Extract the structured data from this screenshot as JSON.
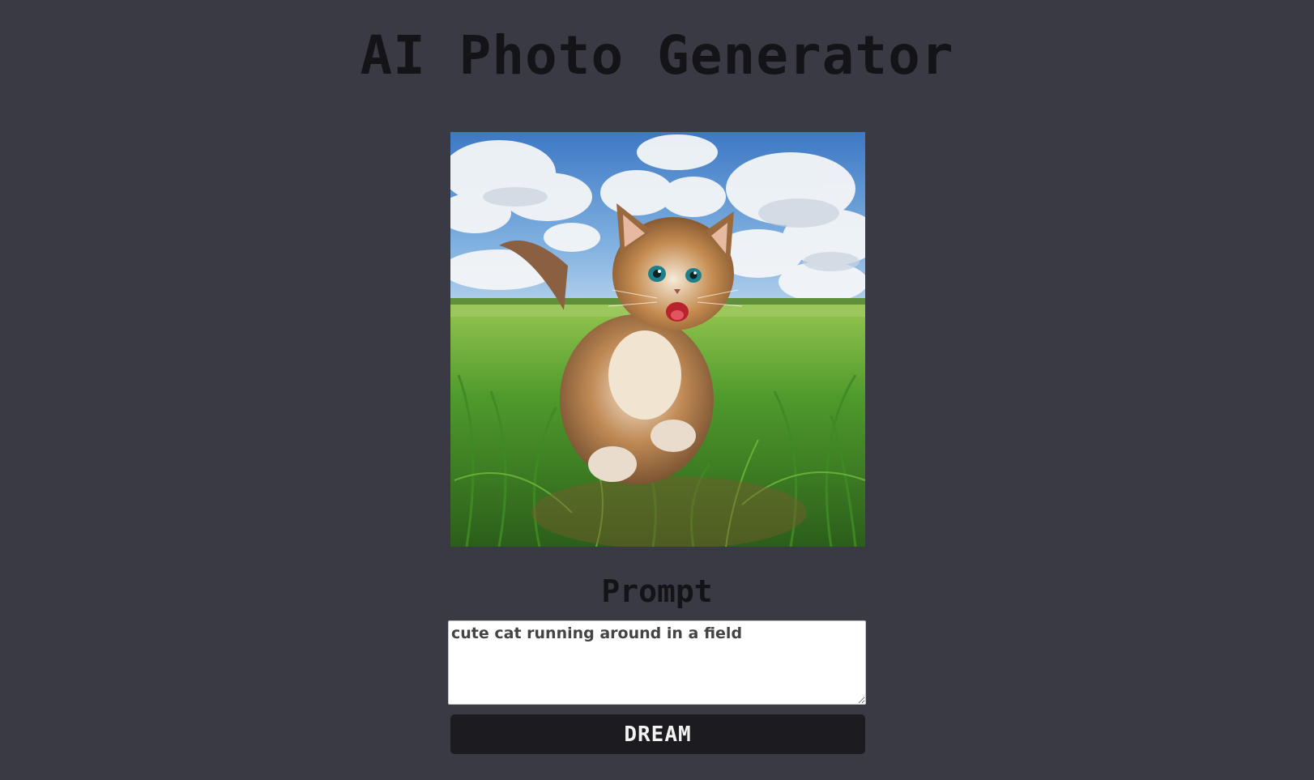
{
  "header": {
    "title": "AI Photo Generator"
  },
  "generated_image": {
    "subject": "kitten running in grass field under cloudy blue sky"
  },
  "prompt_section": {
    "heading": "Prompt",
    "value": "cute cat running around in a field"
  },
  "actions": {
    "submit_label": "DREAM"
  },
  "colors": {
    "background": "#3a3a44",
    "title_text": "#141418",
    "button_bg": "#1c1c20",
    "button_text": "#f2f2f2",
    "input_bg": "#ffffff"
  },
  "icons": {
    "resize_grip": "resize-grip-icon"
  }
}
